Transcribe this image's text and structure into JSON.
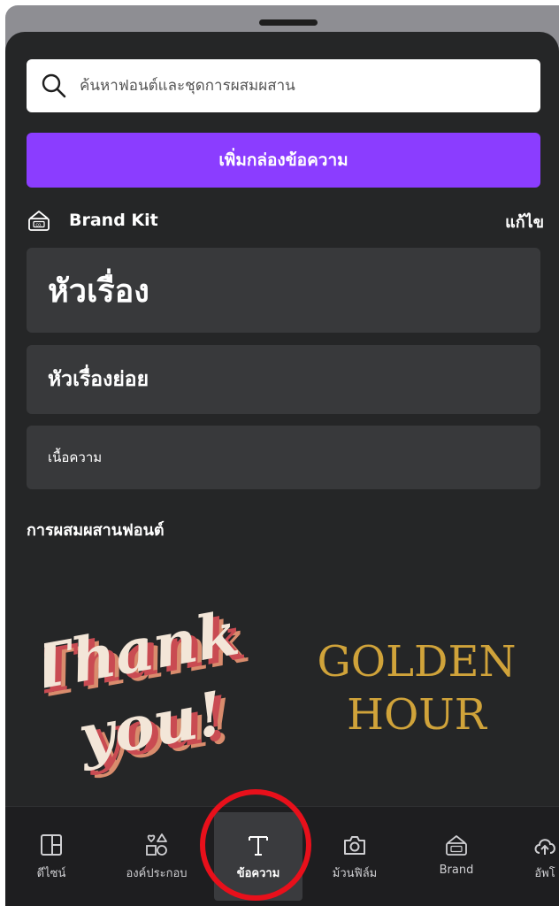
{
  "search": {
    "placeholder": "ค้นหาฟอนต์และชุดการผสมผสาน"
  },
  "add_text_button": {
    "label": "เพิ่มกล่องข้อความ"
  },
  "brand_kit": {
    "icon": "brand-kit-icon",
    "title": "Brand Kit",
    "edit_label": "แก้ไข"
  },
  "text_styles": {
    "heading": "หัวเรื่อง",
    "subheading": "หัวเรื่องย่อย",
    "body": "เนื้อความ"
  },
  "font_combinations": {
    "title": "การผสมผสานฟอนต์",
    "items": [
      {
        "line1": "Thank",
        "line2": "you!",
        "colors": {
          "text": "#f3e6d8",
          "shadow": "#c94b52",
          "shadow2": "#d98c6d"
        }
      },
      {
        "line1": "GOLDEN",
        "line2": "HOUR",
        "colors": {
          "text": "#d0a33a"
        }
      }
    ]
  },
  "tabs": [
    {
      "label": "ดีไซน์",
      "icon": "design-layout-icon",
      "active": false
    },
    {
      "label": "องค์ประกอบ",
      "icon": "elements-shapes-icon",
      "active": false
    },
    {
      "label": "ข้อความ",
      "icon": "text-t-icon",
      "active": true
    },
    {
      "label": "ม้วนฟิล์ม",
      "icon": "camera-icon",
      "active": false
    },
    {
      "label": "Brand",
      "icon": "brand-kit-icon",
      "active": false
    },
    {
      "label": "อัพโ",
      "icon": "upload-cloud-icon",
      "active": false
    }
  ],
  "colors": {
    "accent": "#8b3dff",
    "sheet_background": "#252627",
    "card_background": "#38393b",
    "highlight_ring": "#e8101b"
  }
}
